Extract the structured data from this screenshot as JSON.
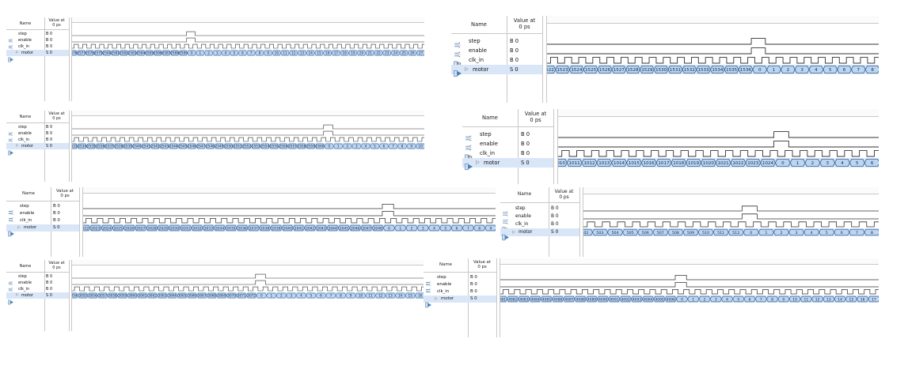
{
  "header": {
    "name_label": "Name",
    "value_label_line1": "Value at",
    "value_label_line2": "0 ps"
  },
  "signals": [
    {
      "name": "step",
      "value": "B 0",
      "icon": "input-signal-icon"
    },
    {
      "name": "enable",
      "value": "B 0",
      "icon": "input-signal-icon"
    },
    {
      "name": "clk_in",
      "value": "B 0",
      "icon": "clock-signal-icon"
    },
    {
      "name": "motor",
      "value": "S 0",
      "icon": "bus-output-icon",
      "expandable": true
    }
  ],
  "panels": [
    {
      "id": "p1",
      "motor_sequence": [
        "2576",
        "2577",
        "2578",
        "2579",
        "2580",
        "2581",
        "2582",
        "2583",
        "2584",
        "2585",
        "2586",
        "2587",
        "2588",
        "2589",
        "0",
        "1",
        "2",
        "3",
        "4",
        "5",
        "6",
        "7",
        "8",
        "9",
        "10",
        "11",
        "12",
        "13",
        "14",
        "15",
        "16",
        "17",
        "18",
        "19",
        "20",
        "21",
        "22",
        "23",
        "24",
        "25",
        "26",
        "27"
      ]
    },
    {
      "id": "p2",
      "motor_sequence": [
        "1522",
        "1523",
        "1524",
        "1525",
        "1526",
        "1527",
        "1528",
        "1529",
        "1530",
        "1531",
        "1532",
        "1533",
        "1534",
        "1535",
        "1536",
        "0",
        "1",
        "2",
        "3",
        "4",
        "5",
        "6",
        "7",
        "8"
      ]
    },
    {
      "id": "p3",
      "motor_sequence": [
        "2533",
        "2534",
        "2535",
        "2536",
        "2537",
        "2538",
        "2539",
        "2540",
        "2541",
        "2542",
        "2543",
        "2544",
        "2545",
        "2546",
        "2547",
        "2548",
        "2549",
        "2550",
        "2551",
        "2552",
        "2553",
        "2554",
        "2555",
        "2556",
        "2557",
        "2558",
        "2559",
        "2560",
        "0",
        "1",
        "2",
        "3",
        "4",
        "5",
        "6",
        "7",
        "8",
        "9",
        "10"
      ]
    },
    {
      "id": "p4",
      "motor_sequence": [
        "1010",
        "1011",
        "1012",
        "1013",
        "1014",
        "1015",
        "1016",
        "1017",
        "1018",
        "1019",
        "1020",
        "1021",
        "1022",
        "1023",
        "1024",
        "0",
        "1",
        "2",
        "3",
        "4",
        "5",
        "6"
      ]
    },
    {
      "id": "p5",
      "motor_sequence": [
        "2022",
        "2023",
        "2024",
        "2025",
        "2026",
        "2027",
        "2028",
        "2029",
        "2030",
        "2031",
        "2032",
        "2033",
        "2034",
        "2035",
        "2036",
        "2037",
        "2038",
        "2039",
        "2040",
        "2041",
        "2042",
        "2043",
        "2044",
        "2045",
        "2046",
        "2047",
        "2048",
        "0",
        "1",
        "2",
        "3",
        "4",
        "5",
        "6",
        "7",
        "8",
        "9"
      ]
    },
    {
      "id": "p6",
      "motor_sequence": [
        "502",
        "503",
        "504",
        "505",
        "506",
        "507",
        "508",
        "509",
        "510",
        "511",
        "512",
        "0",
        "1",
        "2",
        "3",
        "4",
        "5",
        "6",
        "7",
        "8"
      ]
    },
    {
      "id": "p7",
      "motor_sequence": [
        "3054",
        "3055",
        "3056",
        "3057",
        "3058",
        "3059",
        "3060",
        "3061",
        "3062",
        "3063",
        "3064",
        "3065",
        "3066",
        "3067",
        "3068",
        "3069",
        "3070",
        "3071",
        "3072",
        "0",
        "1",
        "2",
        "3",
        "4",
        "5",
        "6",
        "7",
        "8",
        "9",
        "10",
        "11",
        "12",
        "13",
        "14",
        "15",
        "16"
      ]
    },
    {
      "id": "p8",
      "motor_sequence": [
        "4081",
        "4082",
        "4083",
        "4084",
        "4085",
        "4086",
        "4087",
        "4088",
        "4089",
        "4090",
        "4091",
        "4092",
        "4093",
        "4094",
        "4095",
        "4096",
        "0",
        "1",
        "2",
        "3",
        "4",
        "5",
        "6",
        "7",
        "8",
        "9",
        "10",
        "11",
        "12",
        "13",
        "14",
        "15",
        "16",
        "17"
      ]
    }
  ]
}
